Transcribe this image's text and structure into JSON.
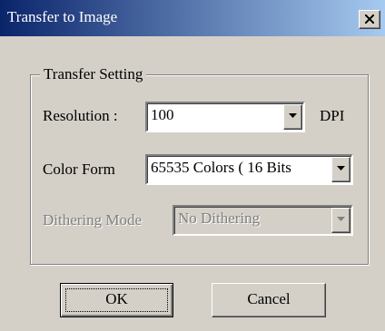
{
  "window": {
    "title": "Transfer to Image"
  },
  "group": {
    "legend": "Transfer Setting"
  },
  "resolution": {
    "label": "Resolution :",
    "value": "100",
    "unit": "DPI"
  },
  "color_form": {
    "label": "Color Form",
    "value": "65535 Colors ( 16 Bits"
  },
  "dithering": {
    "label": "Dithering Mode",
    "value": "No Dithering",
    "enabled": false
  },
  "buttons": {
    "ok": "OK",
    "cancel": "Cancel"
  },
  "icons": {
    "close": "close-icon",
    "dropdown": "chevron-down-icon"
  },
  "colors": {
    "titlebar_start": "#0a246a",
    "titlebar_end": "#a6caf0",
    "face": "#d4d0c8",
    "disabled_text": "#808080"
  }
}
